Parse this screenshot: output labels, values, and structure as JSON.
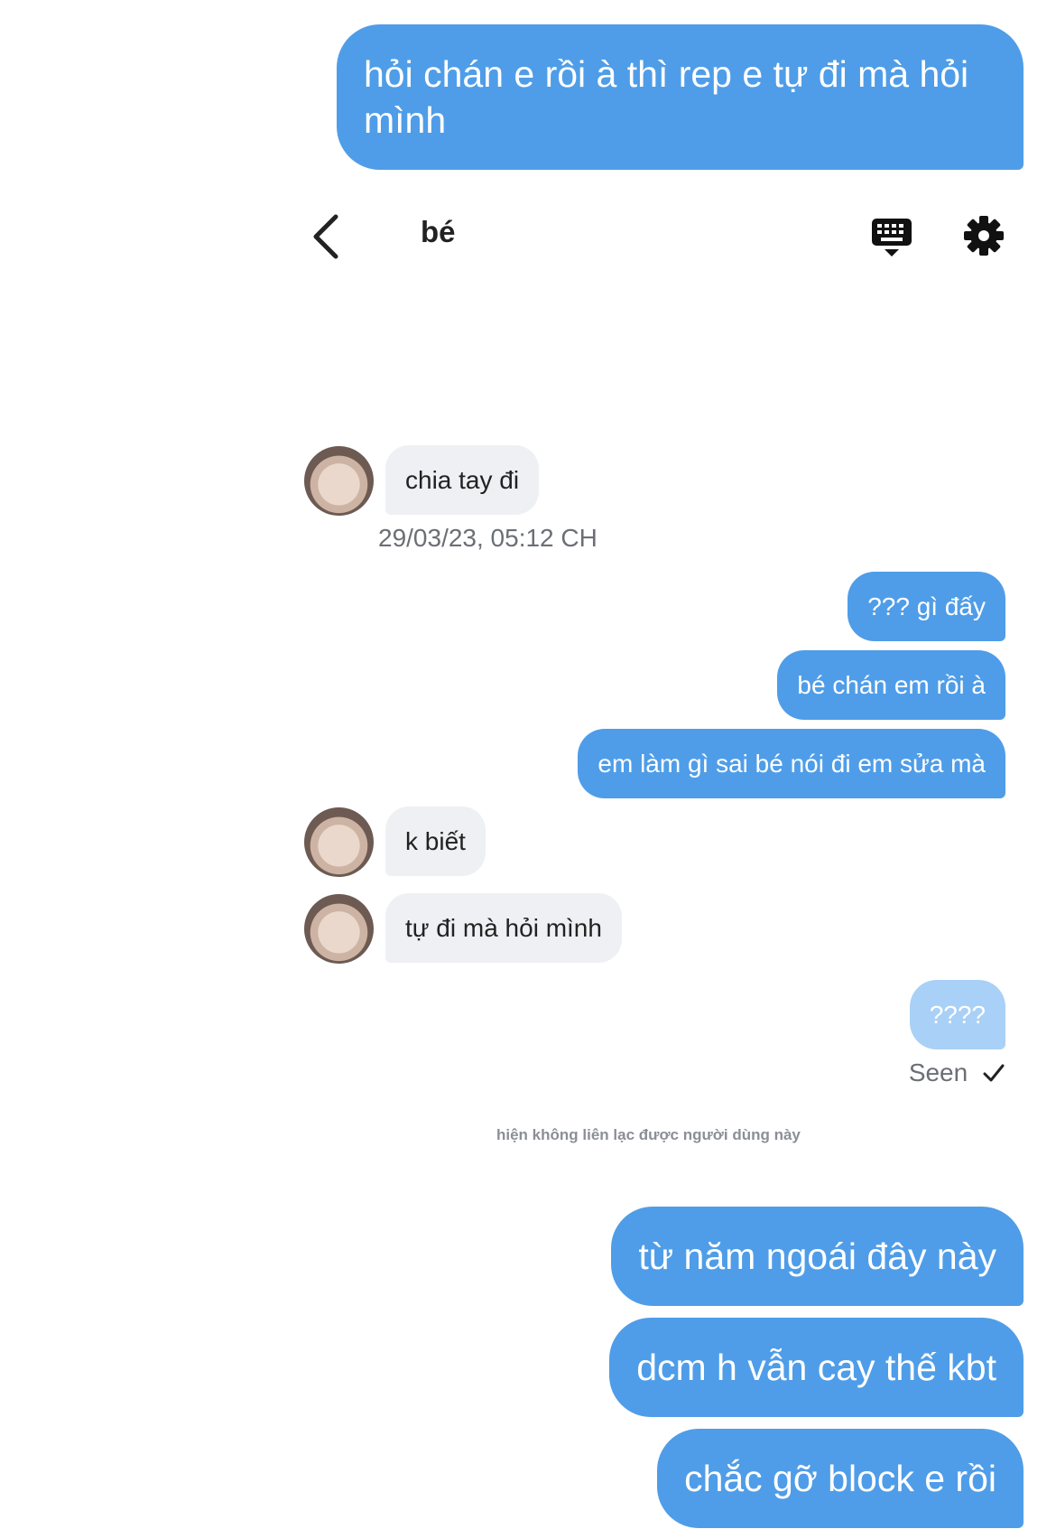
{
  "top_message": "hỏi chán e rồi à thì rep e tự đi mà hỏi mình",
  "header": {
    "title": "bé",
    "back_icon": "chevron-left-icon",
    "keyboard_icon": "keyboard-icon",
    "settings_icon": "gear-icon"
  },
  "conversation": {
    "incoming": [
      {
        "text": "chia tay đi"
      },
      {
        "text": "k biết"
      },
      {
        "text": "tự đi mà hỏi mình"
      }
    ],
    "timestamp": "29/03/23, 05:12 CH",
    "outgoing": [
      {
        "text": "??? gì đấy"
      },
      {
        "text": "bé chán em rồi à"
      },
      {
        "text": "em làm gì sai bé nói đi em sửa mà"
      },
      {
        "text": "????"
      }
    ],
    "seen_label": "Seen",
    "notice": "hiện không liên lạc được người dùng này"
  },
  "bottom_messages": [
    "từ năm ngoái đây này",
    "dcm h vẫn cay thế kbt",
    "chắc gỡ block e rồi"
  ],
  "colors": {
    "outgoing_bubble": "#4f9de8",
    "outgoing_bubble_pending": "#a9d0f6",
    "incoming_bubble": "#eef0f3",
    "background": "#ffffff"
  }
}
